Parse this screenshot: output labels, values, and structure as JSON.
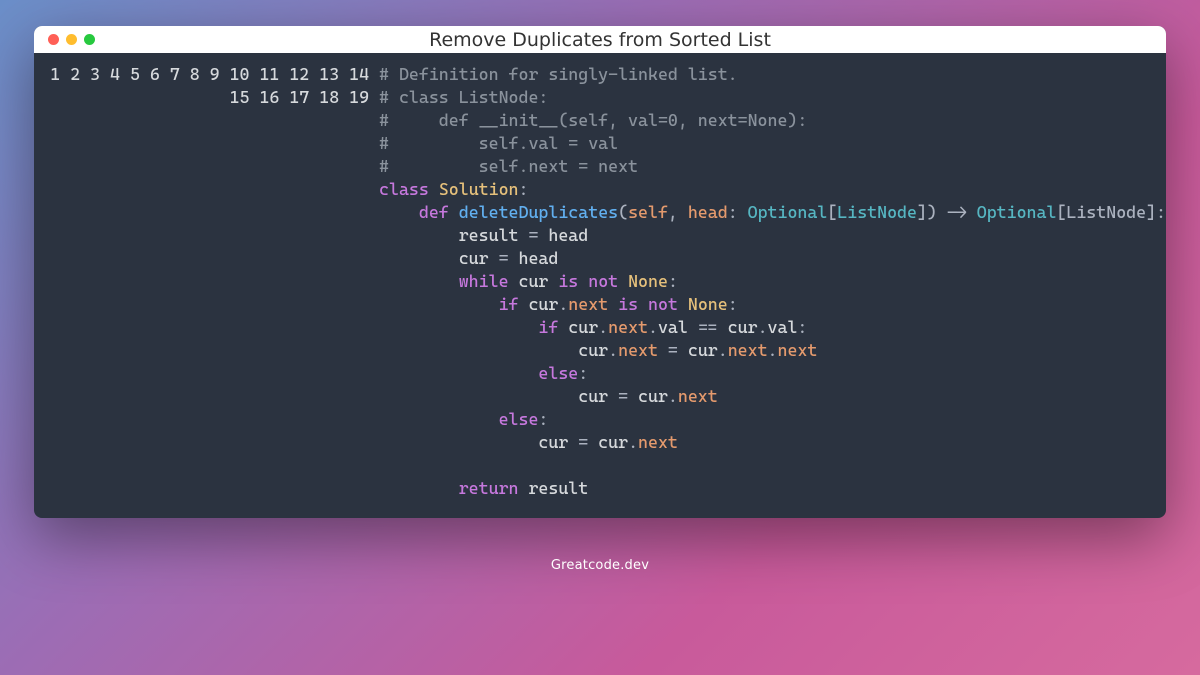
{
  "window": {
    "title": "Remove Duplicates from Sorted List"
  },
  "gutter": {
    "start": 1,
    "end": 19
  },
  "code": {
    "lines": [
      {
        "n": 1,
        "tokens": [
          {
            "c": "comment",
            "t": "# Definition for singly-linked list."
          }
        ]
      },
      {
        "n": 2,
        "tokens": [
          {
            "c": "comment",
            "t": "# class ListNode:"
          }
        ]
      },
      {
        "n": 3,
        "tokens": [
          {
            "c": "comment",
            "t": "#     def __init__(self, val=0, next=None):"
          }
        ]
      },
      {
        "n": 4,
        "tokens": [
          {
            "c": "comment",
            "t": "#         self.val = val"
          }
        ]
      },
      {
        "n": 5,
        "tokens": [
          {
            "c": "comment",
            "t": "#         self.next = next"
          }
        ]
      },
      {
        "n": 6,
        "tokens": [
          {
            "c": "keyword",
            "t": "class"
          },
          {
            "c": "plain",
            "t": " "
          },
          {
            "c": "builtin",
            "t": "Solution"
          },
          {
            "c": "punct",
            "t": ":"
          }
        ]
      },
      {
        "n": 7,
        "tokens": [
          {
            "c": "plain",
            "t": "    "
          },
          {
            "c": "keyword",
            "t": "def"
          },
          {
            "c": "plain",
            "t": " "
          },
          {
            "c": "def-name",
            "t": "deleteDuplicates"
          },
          {
            "c": "punct",
            "t": "("
          },
          {
            "c": "param",
            "t": "self"
          },
          {
            "c": "punct",
            "t": ", "
          },
          {
            "c": "param",
            "t": "head"
          },
          {
            "c": "punct",
            "t": ": "
          },
          {
            "c": "type",
            "t": "Optional"
          },
          {
            "c": "punct",
            "t": "["
          },
          {
            "c": "type",
            "t": "ListNode"
          },
          {
            "c": "punct",
            "t": "]"
          },
          {
            "c": "punct",
            "t": ") "
          },
          {
            "c": "op",
            "t": "->"
          },
          {
            "c": "plain",
            "t": " "
          },
          {
            "c": "type",
            "t": "Optional"
          },
          {
            "c": "punct",
            "t": "[ListNode]:"
          }
        ]
      },
      {
        "n": 8,
        "tokens": [
          {
            "c": "plain",
            "t": "        result "
          },
          {
            "c": "op",
            "t": "="
          },
          {
            "c": "plain",
            "t": " head"
          }
        ]
      },
      {
        "n": 9,
        "tokens": [
          {
            "c": "plain",
            "t": "        cur "
          },
          {
            "c": "op",
            "t": "="
          },
          {
            "c": "plain",
            "t": " head"
          }
        ]
      },
      {
        "n": 10,
        "tokens": [
          {
            "c": "plain",
            "t": "        "
          },
          {
            "c": "keyword",
            "t": "while"
          },
          {
            "c": "plain",
            "t": " cur "
          },
          {
            "c": "keyword",
            "t": "is"
          },
          {
            "c": "plain",
            "t": " "
          },
          {
            "c": "keyword",
            "t": "not"
          },
          {
            "c": "plain",
            "t": " "
          },
          {
            "c": "builtin",
            "t": "None"
          },
          {
            "c": "punct",
            "t": ":"
          }
        ]
      },
      {
        "n": 11,
        "tokens": [
          {
            "c": "plain",
            "t": "            "
          },
          {
            "c": "keyword",
            "t": "if"
          },
          {
            "c": "plain",
            "t": " cur"
          },
          {
            "c": "punct",
            "t": "."
          },
          {
            "c": "attr",
            "t": "next"
          },
          {
            "c": "plain",
            "t": " "
          },
          {
            "c": "keyword",
            "t": "is"
          },
          {
            "c": "plain",
            "t": " "
          },
          {
            "c": "keyword",
            "t": "not"
          },
          {
            "c": "plain",
            "t": " "
          },
          {
            "c": "builtin",
            "t": "None"
          },
          {
            "c": "punct",
            "t": ":"
          }
        ]
      },
      {
        "n": 12,
        "tokens": [
          {
            "c": "plain",
            "t": "                "
          },
          {
            "c": "keyword",
            "t": "if"
          },
          {
            "c": "plain",
            "t": " cur"
          },
          {
            "c": "punct",
            "t": "."
          },
          {
            "c": "attr",
            "t": "next"
          },
          {
            "c": "punct",
            "t": "."
          },
          {
            "c": "plain",
            "t": "val "
          },
          {
            "c": "op",
            "t": "=="
          },
          {
            "c": "plain",
            "t": " cur"
          },
          {
            "c": "punct",
            "t": "."
          },
          {
            "c": "plain",
            "t": "val"
          },
          {
            "c": "punct",
            "t": ":"
          }
        ]
      },
      {
        "n": 13,
        "tokens": [
          {
            "c": "plain",
            "t": "                    cur"
          },
          {
            "c": "punct",
            "t": "."
          },
          {
            "c": "attr",
            "t": "next"
          },
          {
            "c": "plain",
            "t": " "
          },
          {
            "c": "op",
            "t": "="
          },
          {
            "c": "plain",
            "t": " cur"
          },
          {
            "c": "punct",
            "t": "."
          },
          {
            "c": "attr",
            "t": "next"
          },
          {
            "c": "punct",
            "t": "."
          },
          {
            "c": "attr",
            "t": "next"
          }
        ]
      },
      {
        "n": 14,
        "tokens": [
          {
            "c": "plain",
            "t": "                "
          },
          {
            "c": "keyword",
            "t": "else"
          },
          {
            "c": "punct",
            "t": ":"
          }
        ]
      },
      {
        "n": 15,
        "tokens": [
          {
            "c": "plain",
            "t": "                    cur "
          },
          {
            "c": "op",
            "t": "="
          },
          {
            "c": "plain",
            "t": " cur"
          },
          {
            "c": "punct",
            "t": "."
          },
          {
            "c": "attr",
            "t": "next"
          }
        ]
      },
      {
        "n": 16,
        "tokens": [
          {
            "c": "plain",
            "t": "            "
          },
          {
            "c": "keyword",
            "t": "else"
          },
          {
            "c": "punct",
            "t": ":"
          }
        ]
      },
      {
        "n": 17,
        "tokens": [
          {
            "c": "plain",
            "t": "                cur "
          },
          {
            "c": "op",
            "t": "="
          },
          {
            "c": "plain",
            "t": " cur"
          },
          {
            "c": "punct",
            "t": "."
          },
          {
            "c": "attr",
            "t": "next"
          }
        ]
      },
      {
        "n": 18,
        "tokens": [
          {
            "c": "plain",
            "t": ""
          }
        ]
      },
      {
        "n": 19,
        "tokens": [
          {
            "c": "plain",
            "t": "        "
          },
          {
            "c": "keyword",
            "t": "return"
          },
          {
            "c": "plain",
            "t": " result"
          }
        ]
      }
    ]
  },
  "footer": {
    "text": "Greatcode.dev"
  }
}
